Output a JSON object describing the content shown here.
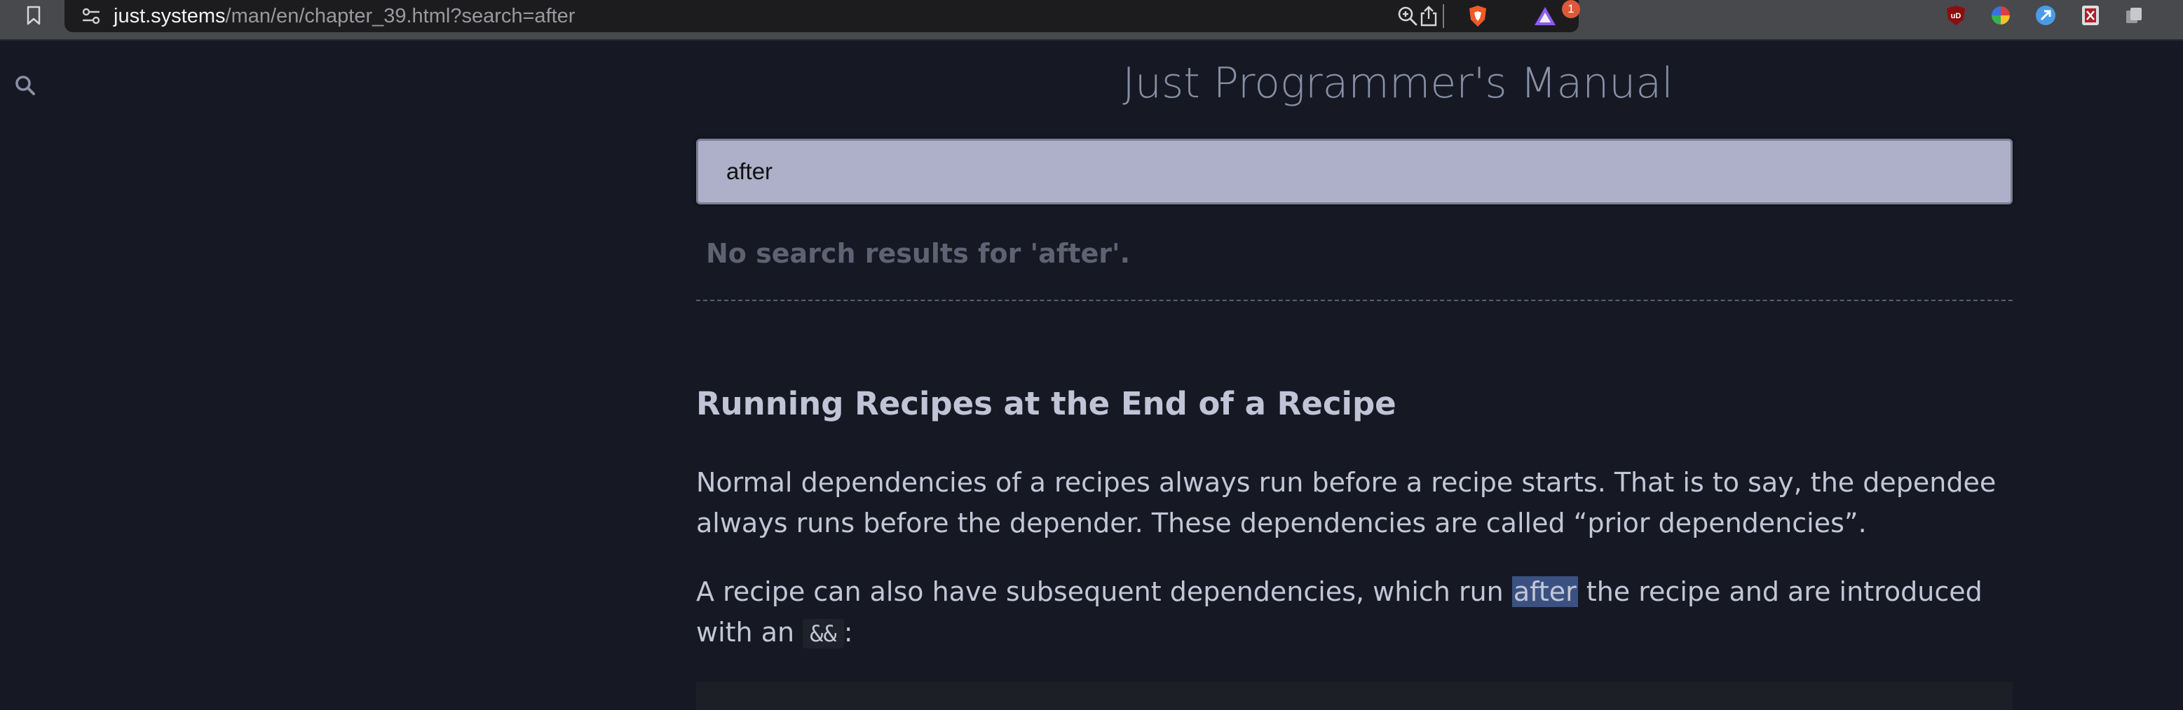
{
  "browser": {
    "url_host": "just.systems",
    "url_path": "/man/en/chapter_39.html?search=after",
    "shields_badge": "1"
  },
  "page": {
    "book_title": "Just Programmer's Manual",
    "search": {
      "value": "after",
      "no_results_text": "No search results for 'after'."
    },
    "section_heading": "Running Recipes at the End of a Recipe",
    "para1": "Normal dependencies of a recipes always run before a recipe starts. That is to say, the dependee always runs before the depender. These dependencies are called “prior dependencies”.",
    "para2": {
      "before": "A recipe can also have subsequent dependencies, which run ",
      "highlight": "after",
      "after": " the recipe and are introduced with an ",
      "code": "&&",
      "end": ":"
    }
  },
  "colors": {
    "page_bg": "#161923",
    "highlight": "#3b5181",
    "search_box_bg": "#aeafc8"
  }
}
